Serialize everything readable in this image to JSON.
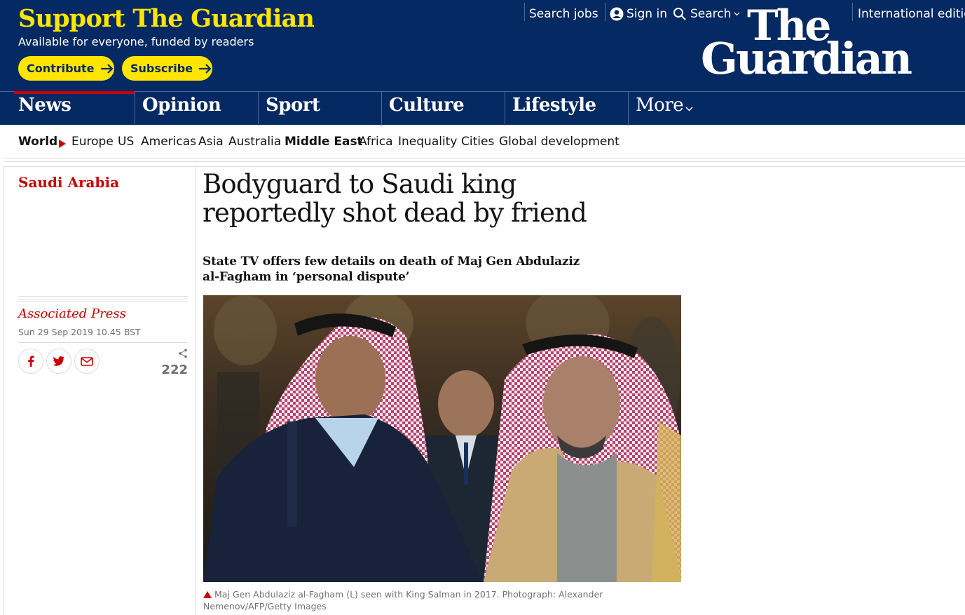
{
  "support": {
    "title": "Support The Guardian",
    "subtitle": "Available for everyone, funded by readers",
    "contribute_label": "Contribute",
    "subscribe_label": "Subscribe"
  },
  "topnav": {
    "search_jobs": "Search jobs",
    "sign_in": "Sign in",
    "search": "Search",
    "edition": "International edition"
  },
  "logo": {
    "line1": "The",
    "line2": "Guardian"
  },
  "pillars": [
    {
      "label": "News",
      "active": true
    },
    {
      "label": "Opinion"
    },
    {
      "label": "Sport"
    },
    {
      "label": "Culture"
    },
    {
      "label": "Lifestyle"
    },
    {
      "label": "More"
    }
  ],
  "subnav": {
    "parent": "World",
    "items": [
      "Europe",
      "US",
      "Americas",
      "Asia",
      "Australia",
      "Middle East",
      "Africa",
      "Inequality",
      "Cities",
      "Global development"
    ],
    "active": "Middle East"
  },
  "article": {
    "section": "Saudi Arabia",
    "headline": "Bodyguard to Saudi king reportedly shot dead by friend",
    "standfirst": "State TV offers few details on death of Maj Gen Abdulaziz al-Fagham in ‘personal dispute’",
    "byline": "Associated Press",
    "date": "Sun 29 Sep 2019 10.45 BST",
    "share_count": "222",
    "caption": "Maj Gen Abdulaziz al-Fagham (L) seen with King Salman in 2017. Photograph: Alexander Nemenov/AFP/Getty Images"
  },
  "colors": {
    "brand_blue": "#052962",
    "support_yellow": "#ffe500",
    "news_red": "#c70000",
    "facebook_red": "#c70000"
  },
  "icons": [
    "arrow-right-icon",
    "user-icon",
    "search-icon",
    "chevron-down-icon",
    "facebook-icon",
    "twitter-icon",
    "email-icon",
    "share-icon",
    "caption-triangle-icon"
  ]
}
